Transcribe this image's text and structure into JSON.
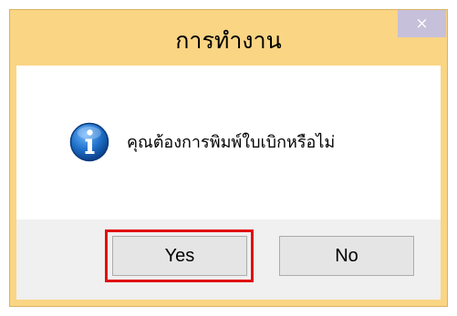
{
  "window": {
    "title": "การทำงาน",
    "close_glyph": "×"
  },
  "message": {
    "icon": "info-icon",
    "text": "คุณต้องการพิมพ์ใบเบิกหรือไม่"
  },
  "buttons": {
    "yes_label": "Yes",
    "no_label": "No"
  },
  "colors": {
    "frame": "#fad584",
    "close_button": "#c7c0da",
    "highlight": "#e01010",
    "icon_blue": "#1e6fc8"
  }
}
